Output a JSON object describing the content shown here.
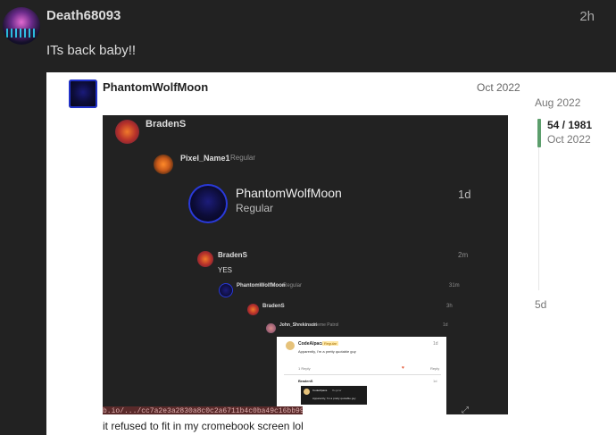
{
  "post": {
    "username": "Death68093",
    "time_ago": "2h",
    "text": "ITs back baby!!"
  },
  "quote": {
    "username": "PhantomWolfMoon",
    "date": "Oct 2022",
    "caption": "it refused to fit in my cromebook screen lol"
  },
  "timeline": {
    "top_date": "Aug 2022",
    "count": "54 / 1981",
    "current_date": "Oct 2022",
    "bottom_label": "5d"
  },
  "screenshot": {
    "top_user": "BradenS",
    "user2": "Pixel_Name1",
    "user2_role": "Regular",
    "big_user": "PhantomWolfMoon",
    "big_role": "Regular",
    "big_time": "1d",
    "reply_user": "BradenS",
    "reply_time": "2m",
    "reply_text": "YES",
    "n1_user": "PhantomWolfMoon",
    "n1_role": "Regular",
    "n1_time": "31m",
    "n2_user": "BradenS",
    "n2_time": "3h",
    "n3_user": "John_Shrekinson",
    "n3_role": "Meme Patrol",
    "n3_time": "1d",
    "card_user": "CodeAlpaca",
    "card_badge": "Regular",
    "card_time": "1d",
    "card_text": "Apparently, I'm a pretty quotable guy",
    "card_replies": "1 Reply",
    "card_reply_btn": "Reply",
    "card2_user": "BradenS",
    "card2_role": "Regular",
    "card2_time": "1d",
    "inner_user": "CodeAlpaca",
    "inner_role": "Regular",
    "inner_text": "Apparently, I'm a pretty quotable guy",
    "url": "b.io/.../cc7a2e3a2830a8c0c2a6711b4c0ba49c16bb99ed.png"
  }
}
